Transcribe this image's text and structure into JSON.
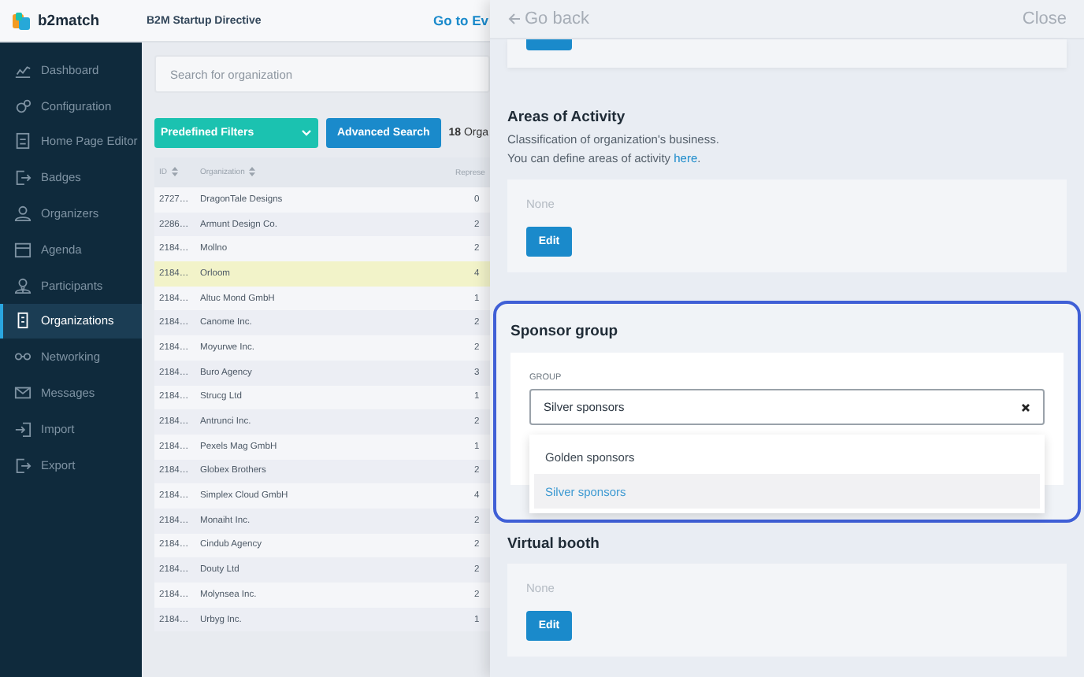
{
  "header": {
    "logo_text": "b2match",
    "event_title": "B2M Startup Directive",
    "link": "Go to Ev"
  },
  "sidebar": {
    "items": [
      {
        "label": "Dashboard",
        "selected": false
      },
      {
        "label": "Configuration",
        "selected": false
      },
      {
        "label": "Home Page Editor",
        "selected": false
      },
      {
        "label": "Badges",
        "selected": false
      },
      {
        "label": "Organizers",
        "selected": false
      },
      {
        "label": "Agenda",
        "selected": false
      },
      {
        "label": "Participants",
        "selected": false
      },
      {
        "label": "Organizations",
        "selected": true
      },
      {
        "label": "Networking",
        "selected": false
      },
      {
        "label": "Messages",
        "selected": false
      },
      {
        "label": "Import",
        "selected": false
      },
      {
        "label": "Export",
        "selected": false
      }
    ]
  },
  "search": {
    "placeholder": "Search for organization"
  },
  "toolbar": {
    "predefined_filters": "Predefined Filters",
    "advanced_search": "Advanced Search",
    "count": "**18** Orga"
  },
  "table": {
    "columns": [
      "ID",
      "Organization",
      "Represe"
    ],
    "rows": [
      {
        "id": "2727…",
        "name": "DragonTale Designs",
        "column_3": "0",
        "selected": false
      },
      {
        "id": "2286…",
        "name": "Armunt Design Co.",
        "column_3": "2",
        "selected": false
      },
      {
        "id": "2184…",
        "name": "Mollno",
        "column_3": "2",
        "selected": false
      },
      {
        "id": "2184…",
        "name": "Orloom",
        "column_3": "4",
        "selected": true
      },
      {
        "id": "2184…",
        "name": "Altuc Mond GmbH",
        "column_3": "1",
        "selected": false
      },
      {
        "id": "2184…",
        "name": "Canome Inc.",
        "column_3": "2",
        "selected": false
      },
      {
        "id": "2184…",
        "name": "Moyurwe Inc.",
        "column_3": "2",
        "selected": false
      },
      {
        "id": "2184…",
        "name": "Buro Agency",
        "column_3": "3",
        "selected": false
      },
      {
        "id": "2184…",
        "name": "Strucg Ltd",
        "column_3": "1",
        "selected": false
      },
      {
        "id": "2184…",
        "name": "Antrunci Inc.",
        "column_3": "2",
        "selected": false
      },
      {
        "id": "2184…",
        "name": "Pexels Mag GmbH",
        "column_3": "1",
        "selected": false
      },
      {
        "id": "2184…",
        "name": "Globex Brothers",
        "column_3": "2",
        "selected": false
      },
      {
        "id": "2184…",
        "name": "Simplex Cloud GmbH",
        "column_3": "4",
        "selected": false
      },
      {
        "id": "2184…",
        "name": "Monaiht Inc.",
        "column_3": "2",
        "selected": false
      },
      {
        "id": "2184…",
        "name": "Cindub Agency",
        "column_3": "2",
        "selected": false
      },
      {
        "id": "2184…",
        "name": "Douty Ltd",
        "column_3": "2",
        "selected": false
      },
      {
        "id": "2184…",
        "name": "Molynsea Inc.",
        "column_3": "2",
        "selected": false
      },
      {
        "id": "2184…",
        "name": "Urbyg Inc.",
        "column_3": "1",
        "selected": false
      }
    ]
  },
  "panel": {
    "back": "Go back",
    "close": "Close",
    "areas_of_activity": {
      "title": "Areas of Activity",
      "description": "Classification of organization's business.",
      "hint": "You can define areas of activity",
      "link": "here",
      "hint_end": ".",
      "value": "None",
      "button": "Edit"
    },
    "sponsor_group": {
      "title": "Sponsor group",
      "highlighted": true,
      "field_label": "GROUP",
      "value": "Silver sponsors",
      "options": [
        {
          "label": "Golden sponsors",
          "selected": false
        },
        {
          "label": "Silver sponsors",
          "selected": true
        }
      ]
    },
    "virtual_booth": {
      "title": "Virtual booth",
      "value": "None",
      "button": "Edit"
    }
  }
}
